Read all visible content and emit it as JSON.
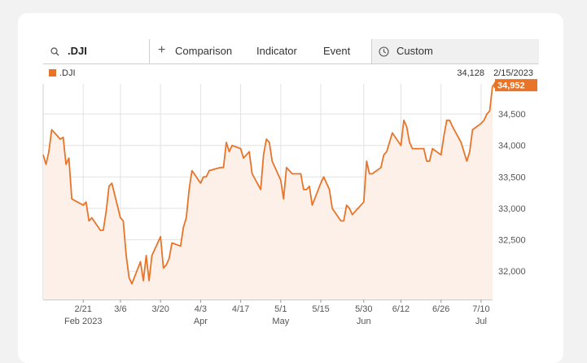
{
  "toolbar": {
    "symbol": ".DJI",
    "comparison_label": "Comparison",
    "indicator_label": "Indicator",
    "event_label": "Event",
    "custom_label": "Custom"
  },
  "legend": {
    "series_name": ".DJI",
    "color": "#e8742a"
  },
  "info": {
    "value": "34,128",
    "date": "2/15/2023"
  },
  "chart_data": {
    "type": "area",
    "title": "",
    "xlabel": "",
    "ylabel": "",
    "ylim": [
      31550,
      34980
    ],
    "y_ticks": [
      32000,
      32500,
      33000,
      33500,
      34000,
      34500
    ],
    "y_tick_labels": [
      "32,000",
      "32,500",
      "33,000",
      "33,500",
      "34,000",
      "34,500"
    ],
    "x_ticks": [
      {
        "date": "2023-02-21",
        "label": "2/21",
        "sub": "Feb 2023"
      },
      {
        "date": "2023-03-06",
        "label": "3/6",
        "sub": ""
      },
      {
        "date": "2023-03-20",
        "label": "3/20",
        "sub": ""
      },
      {
        "date": "2023-04-03",
        "label": "4/3",
        "sub": "Apr"
      },
      {
        "date": "2023-04-17",
        "label": "4/17",
        "sub": ""
      },
      {
        "date": "2023-05-01",
        "label": "5/1",
        "sub": "May"
      },
      {
        "date": "2023-05-15",
        "label": "5/15",
        "sub": ""
      },
      {
        "date": "2023-05-30",
        "label": "5/30",
        "sub": "Jun"
      },
      {
        "date": "2023-06-12",
        "label": "6/12",
        "sub": ""
      },
      {
        "date": "2023-06-26",
        "label": "6/26",
        "sub": ""
      },
      {
        "date": "2023-07-10",
        "label": "7/10",
        "sub": "Jul"
      }
    ],
    "last_value_label": "34,952",
    "series": [
      {
        "name": ".DJI",
        "color": "#e8742a",
        "fill": "#fdf0e8",
        "x": [
          "2023-02-07",
          "2023-02-08",
          "2023-02-09",
          "2023-02-10",
          "2023-02-13",
          "2023-02-14",
          "2023-02-15",
          "2023-02-16",
          "2023-02-17",
          "2023-02-21",
          "2023-02-22",
          "2023-02-23",
          "2023-02-24",
          "2023-02-27",
          "2023-02-28",
          "2023-03-01",
          "2023-03-02",
          "2023-03-03",
          "2023-03-06",
          "2023-03-07",
          "2023-03-08",
          "2023-03-09",
          "2023-03-10",
          "2023-03-13",
          "2023-03-14",
          "2023-03-15",
          "2023-03-16",
          "2023-03-17",
          "2023-03-20",
          "2023-03-21",
          "2023-03-22",
          "2023-03-23",
          "2023-03-24",
          "2023-03-27",
          "2023-03-28",
          "2023-03-29",
          "2023-03-30",
          "2023-03-31",
          "2023-04-03",
          "2023-04-04",
          "2023-04-05",
          "2023-04-06",
          "2023-04-10",
          "2023-04-11",
          "2023-04-12",
          "2023-04-13",
          "2023-04-14",
          "2023-04-17",
          "2023-04-18",
          "2023-04-19",
          "2023-04-20",
          "2023-04-21",
          "2023-04-24",
          "2023-04-25",
          "2023-04-26",
          "2023-04-27",
          "2023-04-28",
          "2023-05-01",
          "2023-05-02",
          "2023-05-03",
          "2023-05-04",
          "2023-05-05",
          "2023-05-08",
          "2023-05-09",
          "2023-05-10",
          "2023-05-11",
          "2023-05-12",
          "2023-05-15",
          "2023-05-16",
          "2023-05-17",
          "2023-05-18",
          "2023-05-19",
          "2023-05-22",
          "2023-05-23",
          "2023-05-24",
          "2023-05-25",
          "2023-05-26",
          "2023-05-30",
          "2023-05-31",
          "2023-06-01",
          "2023-06-02",
          "2023-06-05",
          "2023-06-06",
          "2023-06-07",
          "2023-06-08",
          "2023-06-09",
          "2023-06-12",
          "2023-06-13",
          "2023-06-14",
          "2023-06-15",
          "2023-06-16",
          "2023-06-20",
          "2023-06-21",
          "2023-06-22",
          "2023-06-23",
          "2023-06-26",
          "2023-06-27",
          "2023-06-28",
          "2023-06-29",
          "2023-06-30",
          "2023-07-03",
          "2023-07-05",
          "2023-07-06",
          "2023-07-07",
          "2023-07-10",
          "2023-07-11",
          "2023-07-12",
          "2023-07-13",
          "2023-07-14"
        ],
        "values": [
          33850,
          33700,
          33900,
          34250,
          34100,
          34130,
          33700,
          33800,
          33150,
          33050,
          33100,
          32800,
          32850,
          32650,
          32650,
          32950,
          33350,
          33400,
          32850,
          32800,
          32250,
          31900,
          31800,
          32150,
          31850,
          32250,
          31850,
          32250,
          32550,
          32050,
          32100,
          32200,
          32450,
          32400,
          32700,
          32850,
          33300,
          33600,
          33400,
          33500,
          33500,
          33600,
          33650,
          33650,
          34050,
          33900,
          34000,
          33950,
          33800,
          33850,
          33900,
          33550,
          33300,
          33850,
          34100,
          34050,
          33750,
          33450,
          33150,
          33650,
          33600,
          33550,
          33550,
          33300,
          33300,
          33350,
          33050,
          33400,
          33500,
          33400,
          33300,
          33000,
          32800,
          32800,
          33050,
          33000,
          32900,
          33100,
          33750,
          33550,
          33550,
          33650,
          33850,
          33900,
          34050,
          34200,
          34000,
          34400,
          34300,
          34050,
          33950,
          33950,
          33750,
          33750,
          33950,
          33850,
          34150,
          34400,
          34400,
          34300,
          34050,
          33750,
          33900,
          34250,
          34350,
          34400,
          34500,
          34550,
          34952
        ]
      }
    ]
  }
}
